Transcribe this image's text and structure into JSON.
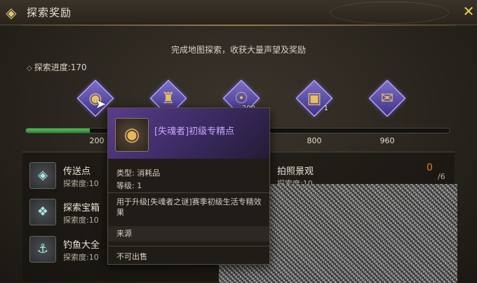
{
  "window": {
    "title": "探索奖励",
    "close_icon": "close-x-icon"
  },
  "header": {
    "subtitle": "完成地图探索，收获大量声望及奖励",
    "progress_label": "探索进度:170"
  },
  "progress": {
    "current": 170,
    "max_marker": 960,
    "fill_fraction": 0.15
  },
  "milestones": [
    {
      "value": "200",
      "icon": "coin-medal-icon",
      "count": ""
    },
    {
      "value": "",
      "icon": "totem-icon",
      "count": ""
    },
    {
      "value": "",
      "icon": "gold-coin-icon",
      "count": "200"
    },
    {
      "value": "800",
      "icon": "treasure-chest-icon",
      "count": "1"
    },
    {
      "value": "960",
      "icon": "scroll-icon",
      "count": ""
    }
  ],
  "categories": [
    {
      "name": "传送点",
      "progress": "探索度:10",
      "icon": "teleport-icon"
    },
    {
      "name": "探索宝箱",
      "progress": "探索度:10",
      "icon": "chest-icon"
    },
    {
      "name": "钓鱼大全",
      "progress": "探索度:10",
      "icon": "fishing-icon"
    },
    {
      "name": "拍照景观",
      "progress": "探索度:10",
      "icon": "camera-icon"
    }
  ],
  "photo_counter": {
    "current": "0",
    "total": "6"
  },
  "tooltip": {
    "title": "[失魂者]初级专精点",
    "type_line": "类型: 消耗品",
    "level_line": "等级: 1",
    "description": "用于升级[失魂者之谜]赛季初级生活专精效果",
    "source_label": "来源",
    "sale_label": "不可出售"
  },
  "colors": {
    "progress_fill": "#3fae4c",
    "badge_purple": "#6a5cc0",
    "tooltip_title": "#c9a6ff",
    "counter": "#e07a2a",
    "close": "#e8d34a"
  }
}
